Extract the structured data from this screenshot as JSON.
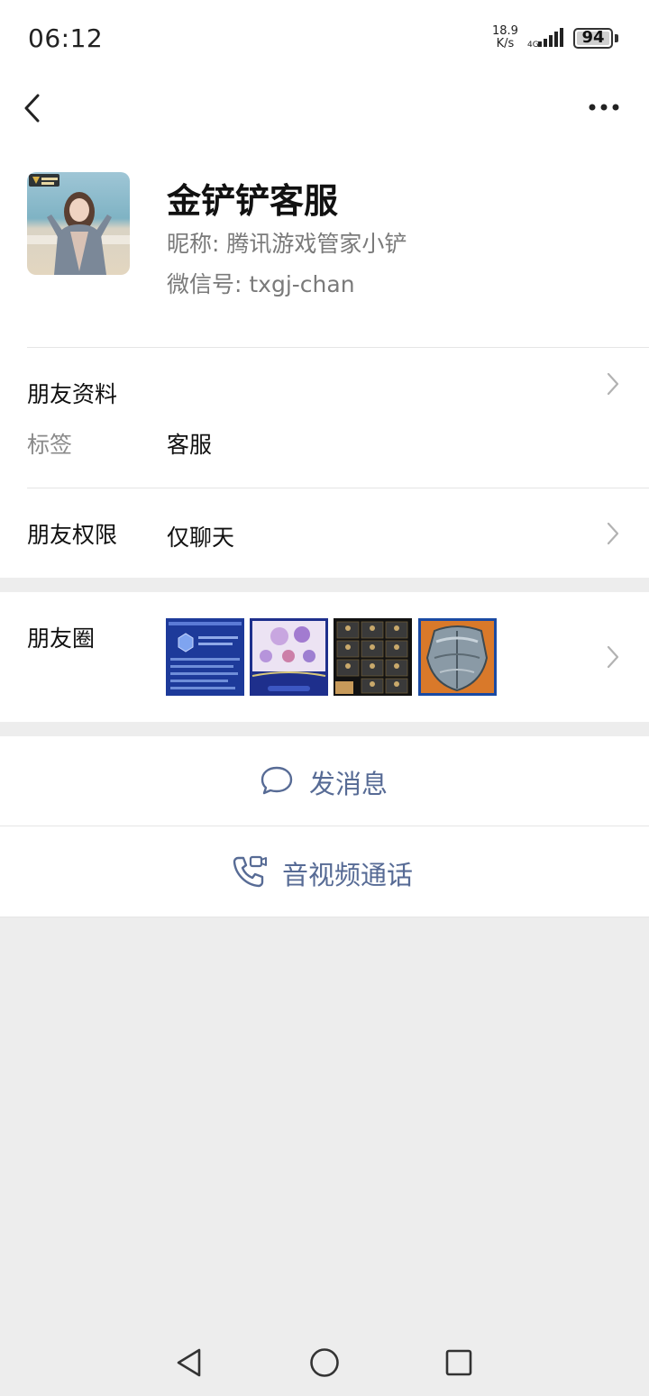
{
  "status_bar": {
    "time": "06:12",
    "net_speed_value": "18.9",
    "net_speed_unit": "K/s",
    "battery": "94"
  },
  "header": {
    "back_icon": "chevron-left-icon",
    "more_icon": "more-dots-icon"
  },
  "profile": {
    "name": "金铲铲客服",
    "nickname": "昵称: 腾讯游戏管家小铲",
    "wechat_id": "微信号: txgj-chan"
  },
  "friend_info": {
    "title": "朋友资料",
    "tag_label": "标签",
    "tag_value": "客服"
  },
  "permissions": {
    "title": "朋友权限",
    "value": "仅聊天"
  },
  "moments": {
    "title": "朋友圈",
    "thumbnails": [
      "moment-1",
      "moment-2",
      "moment-3",
      "moment-4"
    ]
  },
  "actions": {
    "send_message": "发消息",
    "av_call": "音视频通话"
  },
  "colors": {
    "accent": "#576b95",
    "background": "#ededed",
    "card": "#ffffff"
  }
}
